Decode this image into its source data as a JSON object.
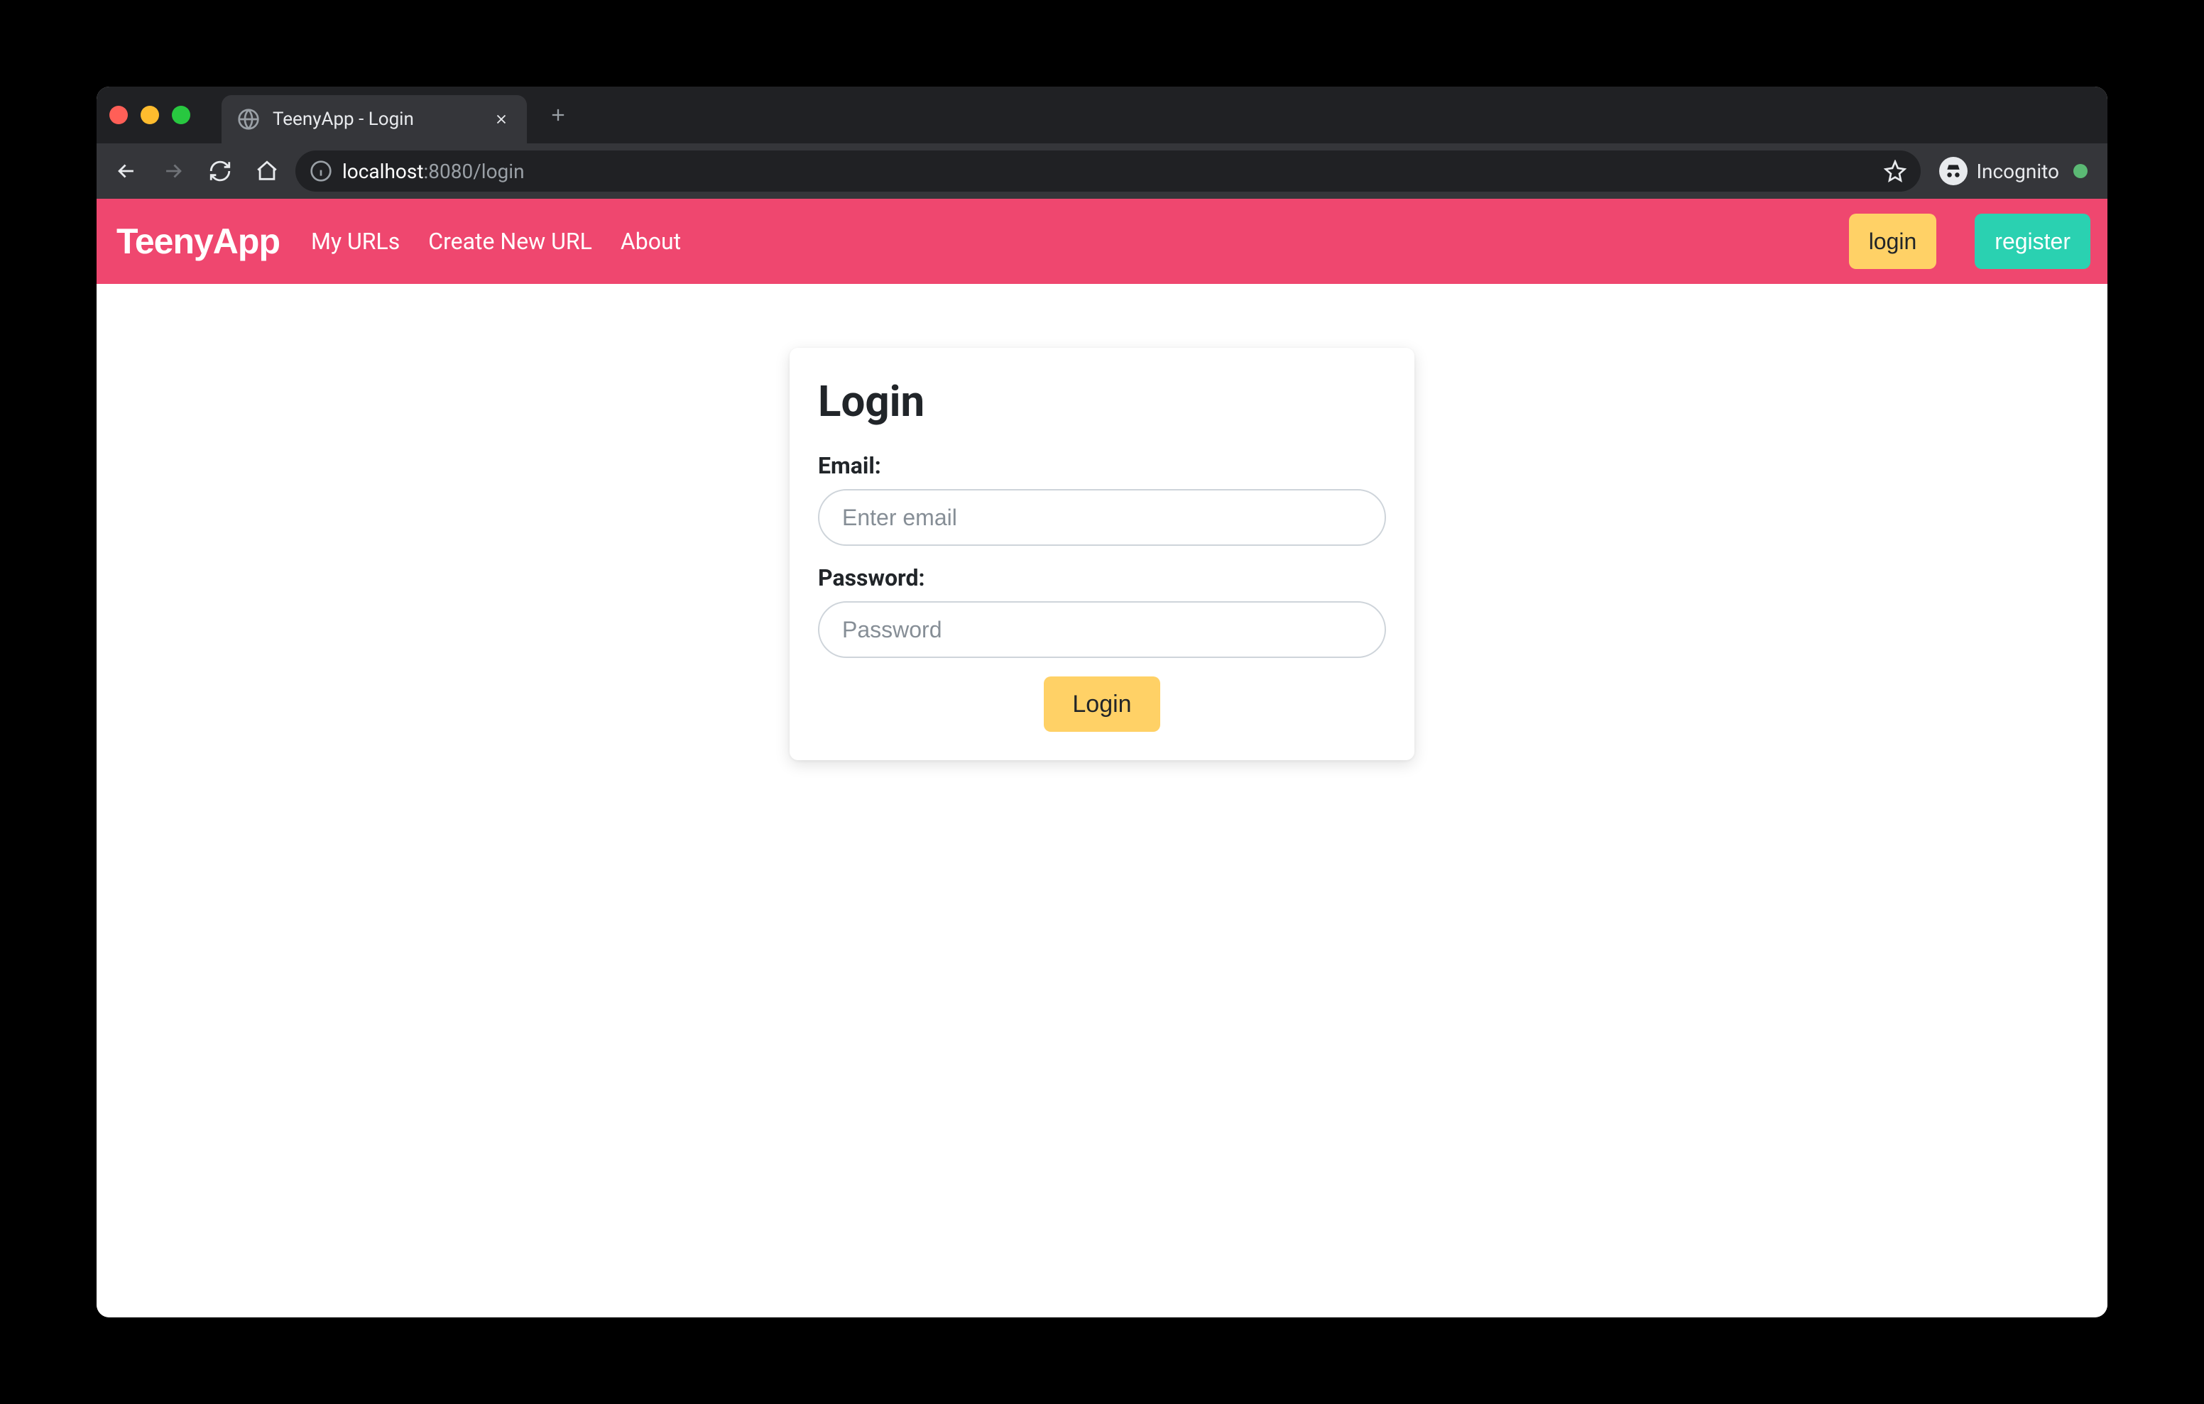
{
  "browser": {
    "tab_title": "TeenyApp - Login",
    "url_host_prefix": "localhost",
    "url_host_suffix": ":8080",
    "url_path": "/login",
    "incognito_label": "Incognito"
  },
  "navbar": {
    "brand": "TeenyApp",
    "links": [
      {
        "label": "My URLs"
      },
      {
        "label": "Create New URL"
      },
      {
        "label": "About"
      }
    ],
    "login_label": "login",
    "register_label": "register"
  },
  "login_form": {
    "heading": "Login",
    "email_label": "Email:",
    "email_placeholder": "Enter email",
    "email_value": "",
    "password_label": "Password:",
    "password_placeholder": "Password",
    "password_value": "",
    "submit_label": "Login"
  },
  "colors": {
    "navbar_bg": "#ef476f",
    "login_btn_bg": "#ffd166",
    "register_btn_bg": "#2ad1b1"
  }
}
